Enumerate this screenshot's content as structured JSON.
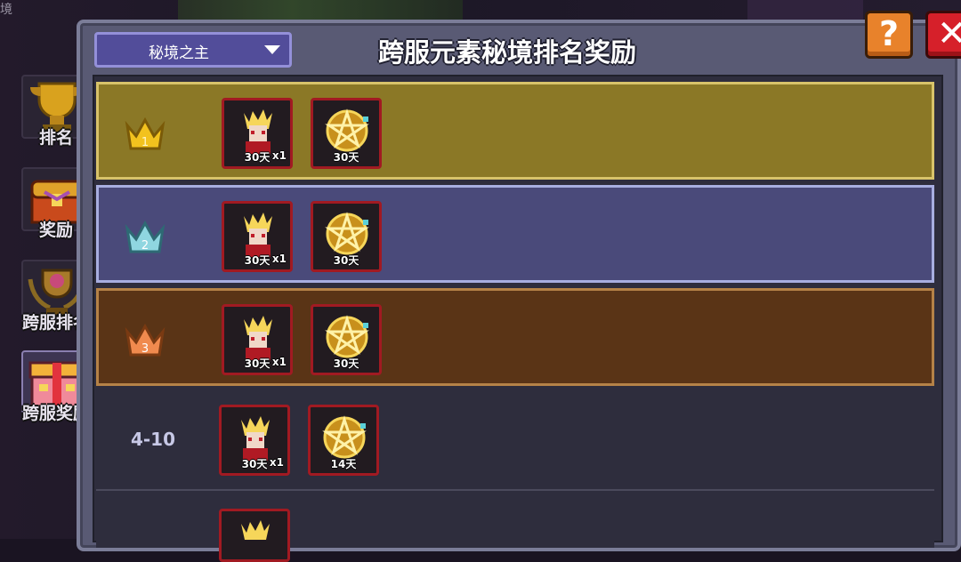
{
  "corner_text": "境",
  "sidebar": {
    "items": [
      {
        "label": "排名",
        "icon": "trophy-icon"
      },
      {
        "label": "奖励",
        "icon": "treasure-chest-icon"
      },
      {
        "label": "跨服排名",
        "icon": "laurel-trophy-icon"
      },
      {
        "label": "跨服奖励",
        "icon": "gift-chest-icon"
      }
    ],
    "active_index": 3
  },
  "header": {
    "dropdown_value": "秘境之主",
    "title": "跨服元素秘境排名奖励",
    "help_label": "?",
    "close_label": "✕"
  },
  "rows": [
    {
      "rank": "1",
      "crown_color": "#f2c21e",
      "rewards": [
        {
          "name": "hero-skin-icon",
          "duration": "30天",
          "qty": "x1"
        },
        {
          "name": "pentagram-frame-icon",
          "duration": "30天",
          "qty": ""
        }
      ]
    },
    {
      "rank": "2",
      "crown_color": "#8fd6e0",
      "rewards": [
        {
          "name": "hero-skin-icon",
          "duration": "30天",
          "qty": "x1"
        },
        {
          "name": "pentagram-frame-icon",
          "duration": "30天",
          "qty": ""
        }
      ]
    },
    {
      "rank": "3",
      "crown_color": "#f08a4e",
      "rewards": [
        {
          "name": "hero-skin-icon",
          "duration": "30天",
          "qty": "x1"
        },
        {
          "name": "pentagram-frame-icon",
          "duration": "30天",
          "qty": ""
        }
      ]
    },
    {
      "rank": "4-10",
      "crown_color": "",
      "rewards": [
        {
          "name": "hero-skin-icon",
          "duration": "30天",
          "qty": "x1"
        },
        {
          "name": "pentagram-frame-icon",
          "duration": "14天",
          "qty": ""
        }
      ]
    }
  ],
  "colors": {
    "row1_bg": "#8b7826",
    "row2_bg": "#4a4a7a",
    "row3_bg": "#5a3416",
    "panel": "#595a74",
    "dropdown": "#524d9a",
    "item_border": "#a11a22"
  }
}
